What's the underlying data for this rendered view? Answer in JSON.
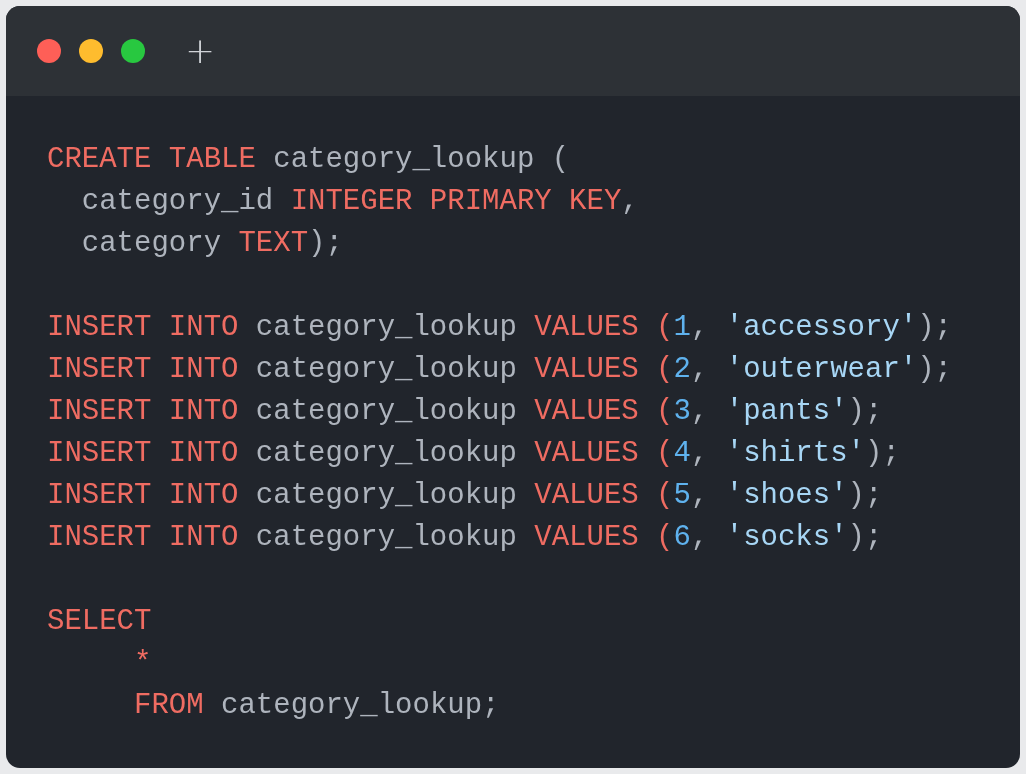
{
  "window": {
    "new_tab_symbol": "+"
  },
  "code_blocks": [
    {
      "lines": [
        [
          {
            "kind": "keyword",
            "text": "CREATE TABLE"
          },
          {
            "kind": "plain",
            "text": " category_lookup ("
          }
        ],
        [
          {
            "kind": "plain",
            "text": "  category_id "
          },
          {
            "kind": "keyword",
            "text": "INTEGER PRIMARY KEY"
          },
          {
            "kind": "plain",
            "text": ","
          }
        ],
        [
          {
            "kind": "plain",
            "text": "  category "
          },
          {
            "kind": "keyword",
            "text": "TEXT"
          },
          {
            "kind": "plain",
            "text": ");"
          }
        ]
      ]
    },
    {
      "lines": [
        [
          {
            "kind": "keyword",
            "text": "INSERT INTO"
          },
          {
            "kind": "plain",
            "text": " category_lookup "
          },
          {
            "kind": "keyword",
            "text": "VALUES ("
          },
          {
            "kind": "number",
            "text": "1"
          },
          {
            "kind": "plain",
            "text": ", "
          },
          {
            "kind": "string",
            "text": "'accessory'"
          },
          {
            "kind": "plain",
            "text": ");"
          }
        ],
        [
          {
            "kind": "keyword",
            "text": "INSERT INTO"
          },
          {
            "kind": "plain",
            "text": " category_lookup "
          },
          {
            "kind": "keyword",
            "text": "VALUES ("
          },
          {
            "kind": "number",
            "text": "2"
          },
          {
            "kind": "plain",
            "text": ", "
          },
          {
            "kind": "string",
            "text": "'outerwear'"
          },
          {
            "kind": "plain",
            "text": ");"
          }
        ],
        [
          {
            "kind": "keyword",
            "text": "INSERT INTO"
          },
          {
            "kind": "plain",
            "text": " category_lookup "
          },
          {
            "kind": "keyword",
            "text": "VALUES ("
          },
          {
            "kind": "number",
            "text": "3"
          },
          {
            "kind": "plain",
            "text": ", "
          },
          {
            "kind": "string",
            "text": "'pants'"
          },
          {
            "kind": "plain",
            "text": ");"
          }
        ],
        [
          {
            "kind": "keyword",
            "text": "INSERT INTO"
          },
          {
            "kind": "plain",
            "text": " category_lookup "
          },
          {
            "kind": "keyword",
            "text": "VALUES ("
          },
          {
            "kind": "number",
            "text": "4"
          },
          {
            "kind": "plain",
            "text": ", "
          },
          {
            "kind": "string",
            "text": "'shirts'"
          },
          {
            "kind": "plain",
            "text": ");"
          }
        ],
        [
          {
            "kind": "keyword",
            "text": "INSERT INTO"
          },
          {
            "kind": "plain",
            "text": " category_lookup "
          },
          {
            "kind": "keyword",
            "text": "VALUES ("
          },
          {
            "kind": "number",
            "text": "5"
          },
          {
            "kind": "plain",
            "text": ", "
          },
          {
            "kind": "string",
            "text": "'shoes'"
          },
          {
            "kind": "plain",
            "text": ");"
          }
        ],
        [
          {
            "kind": "keyword",
            "text": "INSERT INTO"
          },
          {
            "kind": "plain",
            "text": " category_lookup "
          },
          {
            "kind": "keyword",
            "text": "VALUES ("
          },
          {
            "kind": "number",
            "text": "6"
          },
          {
            "kind": "plain",
            "text": ", "
          },
          {
            "kind": "string",
            "text": "'socks'"
          },
          {
            "kind": "plain",
            "text": ");"
          }
        ]
      ]
    },
    {
      "lines": [
        [
          {
            "kind": "keyword",
            "text": "SELECT"
          }
        ],
        [
          {
            "kind": "keyword",
            "text": "     *"
          }
        ],
        [
          {
            "kind": "keyword",
            "text": "     FROM"
          },
          {
            "kind": "plain",
            "text": " category_lookup;"
          }
        ]
      ]
    }
  ]
}
